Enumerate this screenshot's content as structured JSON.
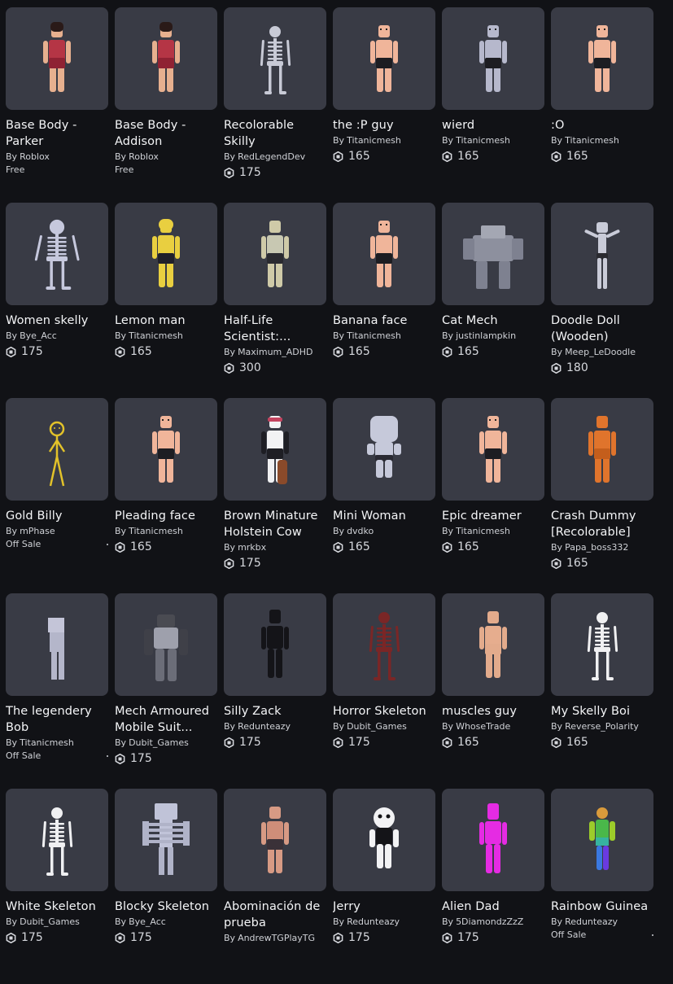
{
  "by_prefix": "By",
  "items": [
    {
      "name": "Base Body -\nParker",
      "creator": "Roblox",
      "price": "",
      "status": "Free",
      "fig": "girl"
    },
    {
      "name": "Base Body -\nAddison",
      "creator": "Roblox",
      "price": "",
      "status": "Free",
      "fig": "girl"
    },
    {
      "name": "Recolorable\nSkilly",
      "creator": "RedLegendDev",
      "price": "175",
      "status": "",
      "fig": "wire"
    },
    {
      "name": "the :P guy",
      "creator": "Titanicmesh",
      "price": "165",
      "status": "",
      "fig": "skin"
    },
    {
      "name": "wierd",
      "creator": "Titanicmesh",
      "price": "165",
      "status": "",
      "fig": "grey"
    },
    {
      "name": ":O",
      "creator": "Titanicmesh",
      "price": "165",
      "status": "",
      "fig": "skin"
    },
    {
      "name": "Women skelly",
      "creator": "Bye_Acc",
      "price": "175",
      "status": "",
      "fig": "skelwide"
    },
    {
      "name": "Lemon man",
      "creator": "Titanicmesh",
      "price": "165",
      "status": "",
      "fig": "yellow"
    },
    {
      "name": "Half-Life\nScientist:...",
      "creator": "Maximum_ADHD",
      "price": "300",
      "status": "",
      "fig": "scientist"
    },
    {
      "name": "Banana face",
      "creator": "Titanicmesh",
      "price": "165",
      "status": "",
      "fig": "skin"
    },
    {
      "name": "Cat Mech",
      "creator": "justinlampkin",
      "price": "165",
      "status": "",
      "fig": "mech"
    },
    {
      "name": "Doodle Doll\n(Wooden)",
      "creator": "Meep_LeDoodle",
      "price": "180",
      "status": "",
      "fig": "doodle"
    },
    {
      "name": "Gold Billy",
      "creator": "mPhase",
      "price": "",
      "status": "Off Sale",
      "fig": "gold"
    },
    {
      "name": "Pleading face",
      "creator": "Titanicmesh",
      "price": "165",
      "status": "",
      "fig": "skin"
    },
    {
      "name": "Brown Minature\nHolstein Cow",
      "creator": "mrkbx",
      "price": "175",
      "status": "",
      "fig": "cow"
    },
    {
      "name": "Mini Woman",
      "creator": "dvdko",
      "price": "165",
      "status": "",
      "fig": "mini"
    },
    {
      "name": "Epic dreamer",
      "creator": "Titanicmesh",
      "price": "165",
      "status": "",
      "fig": "skin"
    },
    {
      "name": "Crash Dummy\n[Recolorable]",
      "creator": "Papa_boss332",
      "price": "165",
      "status": "",
      "fig": "orange"
    },
    {
      "name": "The legendery\nBob",
      "creator": "Titanicmesh",
      "price": "",
      "status": "Off Sale",
      "fig": "block"
    },
    {
      "name": "Mech Armoured\nMobile Suit...",
      "creator": "Dubit_Games",
      "price": "175",
      "status": "",
      "fig": "mecharmor"
    },
    {
      "name": "Silly Zack",
      "creator": "Redunteazy",
      "price": "175",
      "status": "",
      "fig": "black"
    },
    {
      "name": "Horror Skeleton",
      "creator": "Dubit_Games",
      "price": "175",
      "status": "",
      "fig": "horror"
    },
    {
      "name": "muscles guy",
      "creator": "WhoseTrade",
      "price": "165",
      "status": "",
      "fig": "muscle"
    },
    {
      "name": "My Skelly Boi",
      "creator": "Reverse_Polarity",
      "price": "165",
      "status": "",
      "fig": "skelwhite"
    },
    {
      "name": "White Skeleton",
      "creator": "Dubit_Games",
      "price": "175",
      "status": "",
      "fig": "skelwhite"
    },
    {
      "name": "Blocky Skeleton",
      "creator": "Bye_Acc",
      "price": "175",
      "status": "",
      "fig": "blockskel"
    },
    {
      "name": "Abominación de\nprueba",
      "creator": "AndrewTGPlayTG",
      "price": "",
      "status": "",
      "fig": "abom"
    },
    {
      "name": "Jerry",
      "creator": "Redunteazy",
      "price": "175",
      "status": "",
      "fig": "jerry"
    },
    {
      "name": "Alien Dad",
      "creator": "5DiamondzZzZ",
      "price": "175",
      "status": "",
      "fig": "alien"
    },
    {
      "name": "Rainbow Guinea",
      "creator": "Redunteazy",
      "price": "",
      "status": "Off Sale",
      "fig": "rainbow"
    }
  ]
}
